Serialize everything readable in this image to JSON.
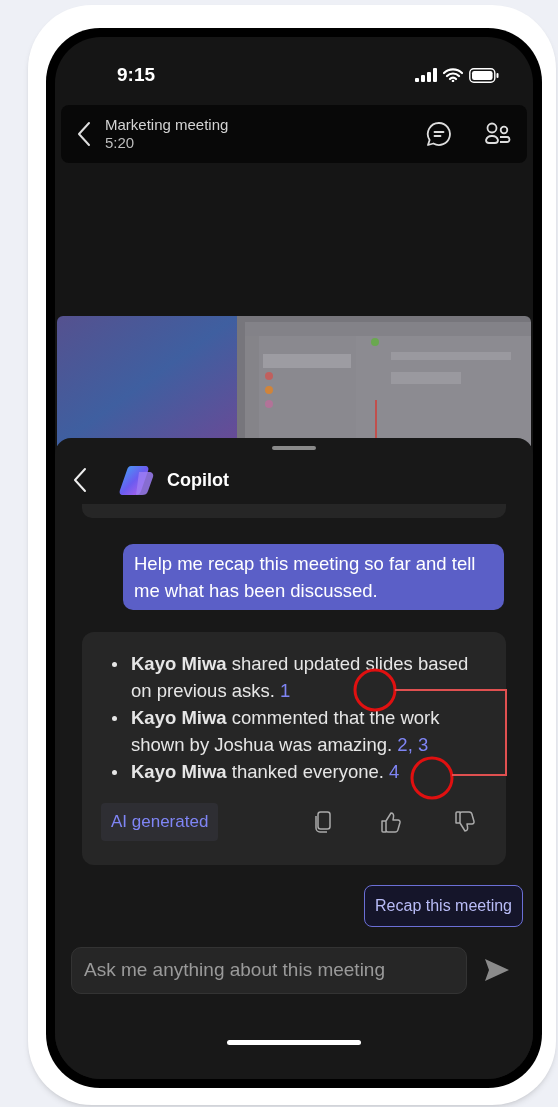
{
  "status_bar": {
    "time": "9:15"
  },
  "meeting": {
    "title": "Marketing meeting",
    "duration": "5:20"
  },
  "copilot": {
    "title": "Copilot",
    "prompt": "Help me recap this meeting so far and tell me what has been discussed.",
    "response": [
      {
        "text": "**Kayo Miwa** shared updated slides based on previous asks.",
        "citation": "1"
      },
      {
        "text": "**Kayo Miwa** commented that the work shown by Joshua was amazing.",
        "citation": "2, 3"
      },
      {
        "text": "**Kayo Miwa** thanked everyone.",
        "citation": "4"
      }
    ],
    "badge": "AI generated",
    "suggestion": "Recap this meeting",
    "input": {
      "placeholder": "Ask me anything about this meeting"
    }
  }
}
